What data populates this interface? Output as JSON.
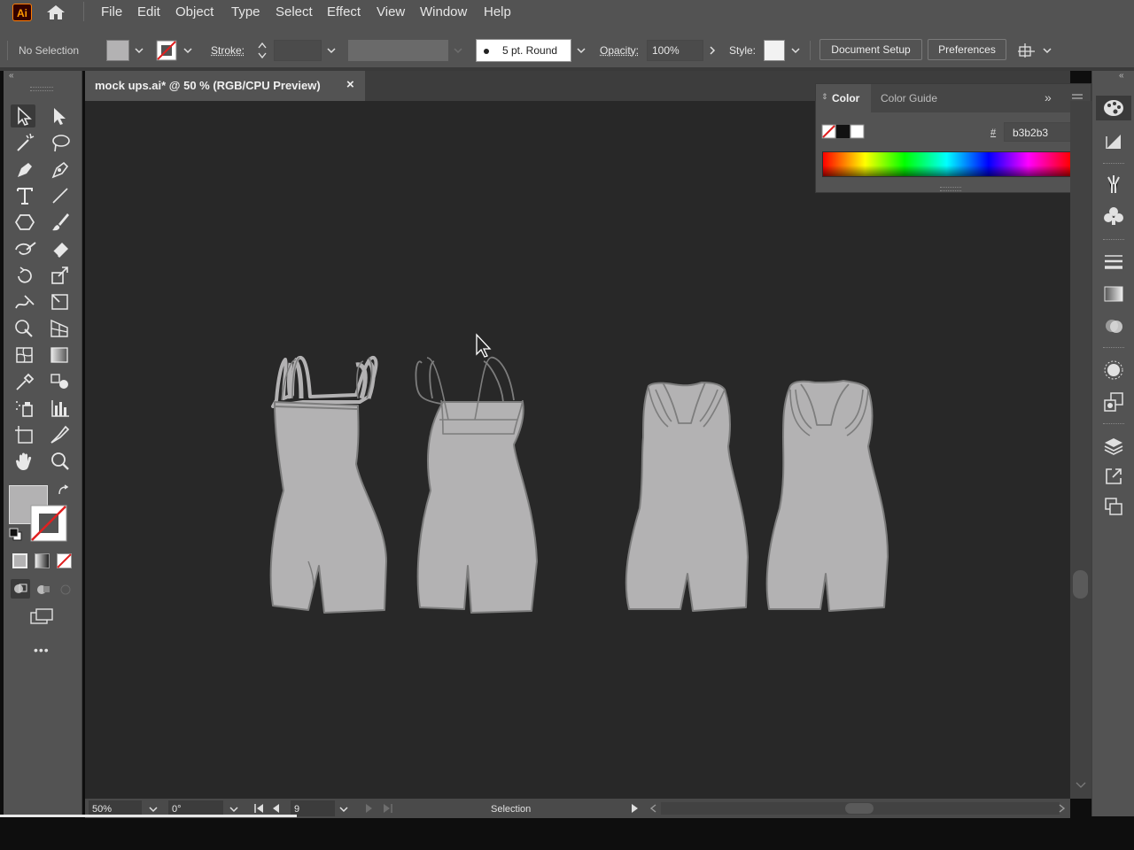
{
  "app": {
    "logo": "Ai"
  },
  "menu": [
    "File",
    "Edit",
    "Object",
    "Type",
    "Select",
    "Effect",
    "View",
    "Window",
    "Help"
  ],
  "control": {
    "selection_label": "No Selection",
    "stroke_label": "Stroke:",
    "brush_label": "5 pt. Round",
    "opacity_label": "Opacity:",
    "opacity_value": "100%",
    "style_label": "Style:",
    "doc_setup": "Document Setup",
    "preferences": "Preferences"
  },
  "document": {
    "tab_title": "mock ups.ai* @ 50 % (RGB/CPU Preview)",
    "close": "×"
  },
  "color_panel": {
    "tabs": [
      "Color",
      "Color Guide"
    ],
    "hex_symbol": "#",
    "hex_value": "b3b2b3"
  },
  "status": {
    "zoom": "50%",
    "rotation": "0°",
    "artboard": "9",
    "tool": "Selection"
  },
  "colors": {
    "ui": "#535353",
    "canvas": "#282828",
    "garment_fill": "#b3b2b3",
    "garment_stroke": "#7d7d7d"
  },
  "toolbar": {
    "more": "•••"
  }
}
